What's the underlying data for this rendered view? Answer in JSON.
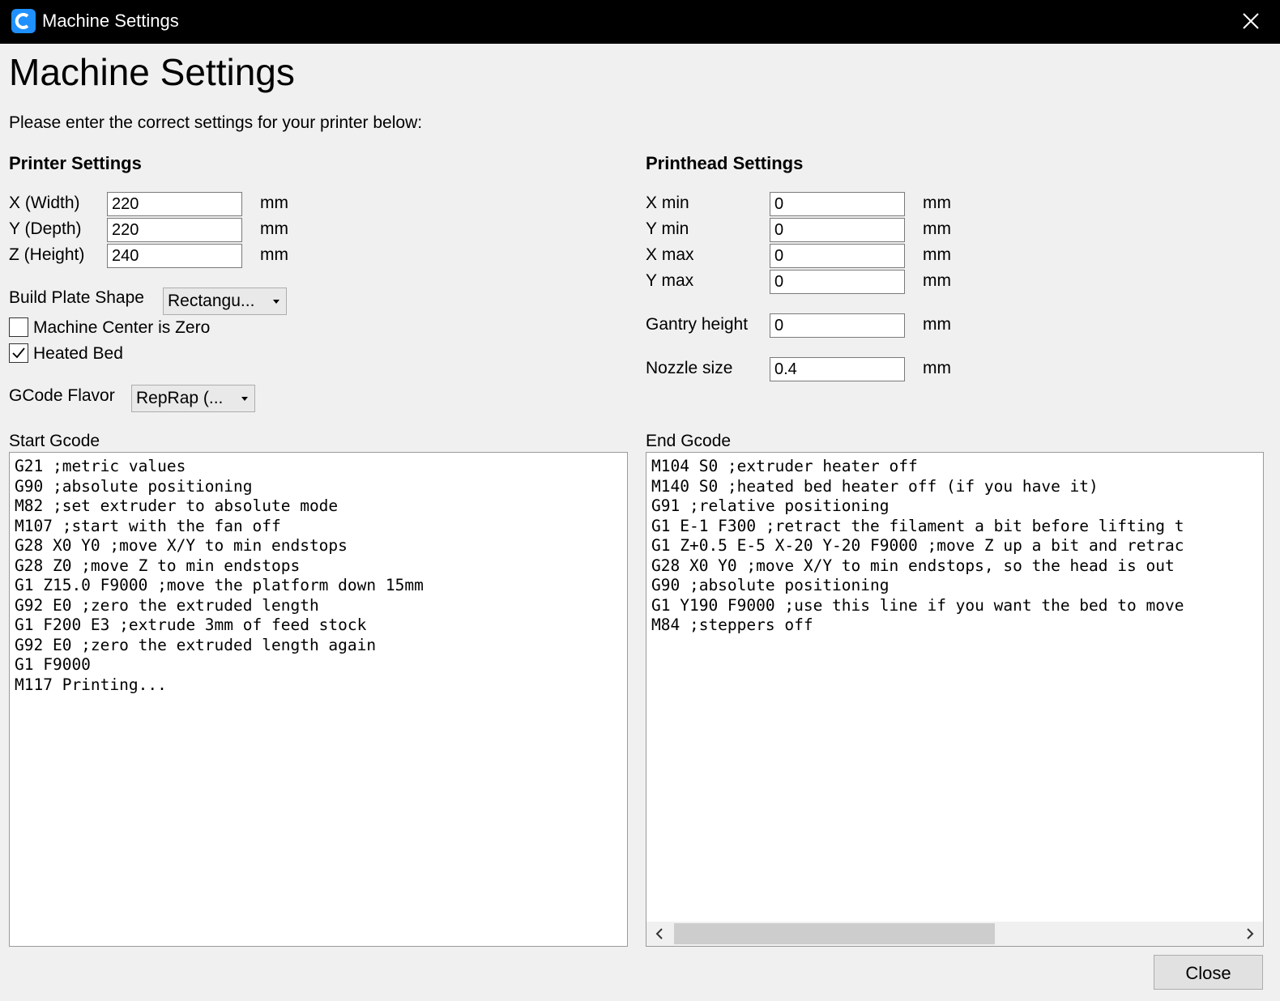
{
  "window": {
    "title": "Machine Settings",
    "app_icon": "cura-logo-icon",
    "close_icon": "close-icon"
  },
  "heading": "Machine Settings",
  "intro": "Please enter the correct settings for your printer below:",
  "printer": {
    "title": "Printer Settings",
    "fields": [
      {
        "label": "X (Width)",
        "value": "220",
        "unit": "mm"
      },
      {
        "label": "Y (Depth)",
        "value": "220",
        "unit": "mm"
      },
      {
        "label": "Z (Height)",
        "value": "240",
        "unit": "mm"
      }
    ],
    "build_plate": {
      "label": "Build Plate Shape",
      "value": "Rectangu..."
    },
    "center_zero": {
      "label": "Machine Center is Zero",
      "checked": false
    },
    "heated_bed": {
      "label": "Heated Bed",
      "checked": true
    },
    "gcode_flavor": {
      "label": "GCode Flavor",
      "value": "RepRap (..."
    }
  },
  "printhead": {
    "title": "Printhead Settings",
    "fields": [
      {
        "label": "X min",
        "value": "0",
        "unit": "mm"
      },
      {
        "label": "Y min",
        "value": "0",
        "unit": "mm"
      },
      {
        "label": "X max",
        "value": "0",
        "unit": "mm"
      },
      {
        "label": "Y max",
        "value": "0",
        "unit": "mm"
      }
    ],
    "gantry": {
      "label": "Gantry height",
      "value": "0",
      "unit": "mm"
    },
    "nozzle": {
      "label": "Nozzle size",
      "value": "0.4",
      "unit": "mm"
    }
  },
  "start_gcode": {
    "label": "Start Gcode",
    "lines": [
      "G21 ;metric values",
      "G90 ;absolute positioning",
      "M82 ;set extruder to absolute mode",
      "M107 ;start with the fan off",
      "G28 X0 Y0 ;move X/Y to min endstops",
      "G28 Z0 ;move Z to min endstops",
      "G1 Z15.0 F9000 ;move the platform down 15mm",
      "G92 E0 ;zero the extruded length",
      "G1 F200 E3 ;extrude 3mm of feed stock",
      "G92 E0 ;zero the extruded length again",
      "G1 F9000",
      "M117 Printing..."
    ]
  },
  "end_gcode": {
    "label": "End Gcode",
    "lines": [
      "M104 S0 ;extruder heater off",
      "M140 S0 ;heated bed heater off (if you have it)",
      "G91 ;relative positioning",
      "G1 E-1 F300 ;retract the filament a bit before lifting t",
      "G1 Z+0.5 E-5 X-20 Y-20 F9000 ;move Z up a bit and retrac",
      "G28 X0 Y0 ;move X/Y to min endstops, so the head is out",
      "G90 ;absolute positioning",
      "G1 Y190 F9000 ;use this line if you want the bed to move",
      "M84 ;steppers off"
    ]
  },
  "close_button": "Close"
}
